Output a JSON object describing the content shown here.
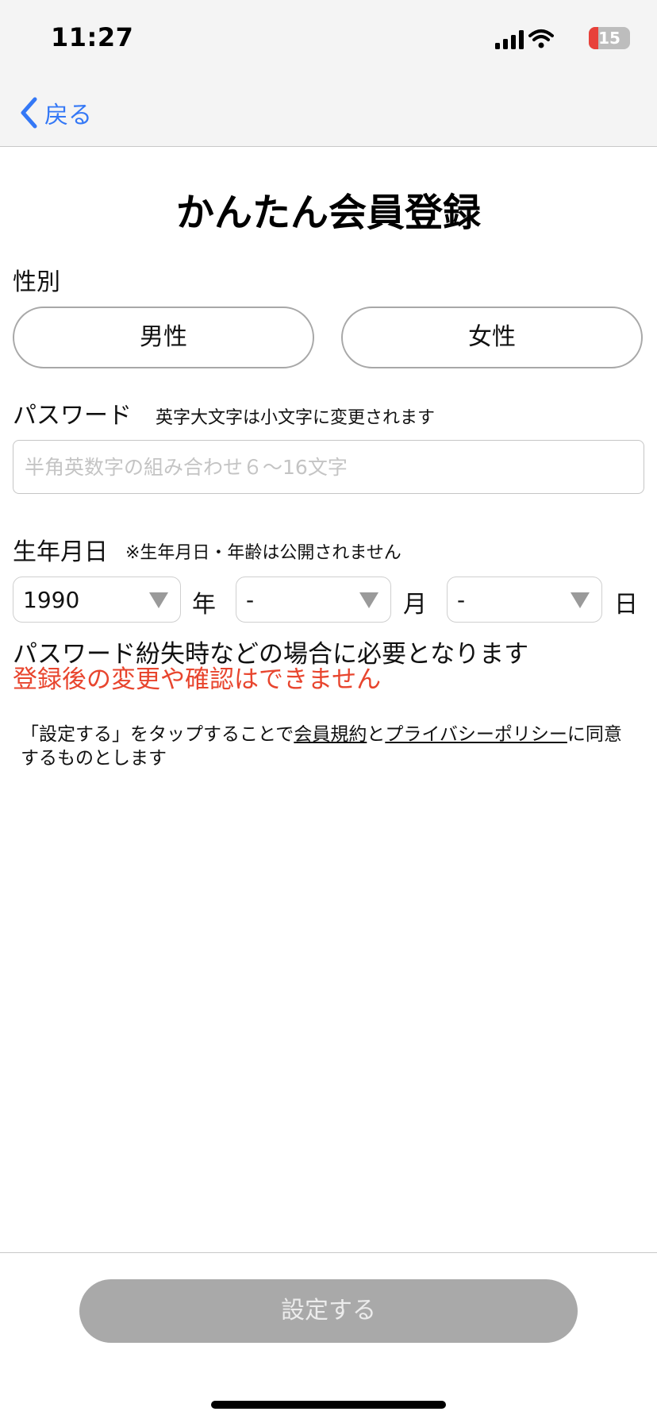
{
  "status_bar": {
    "time": "11:27",
    "battery_level": "15",
    "battery_color": "#e8413a"
  },
  "nav": {
    "back_label": "戻る",
    "back_icon": "chevron-left-icon",
    "accent_color": "#3478f6"
  },
  "title": "かんたん会員登録",
  "gender": {
    "label": "性別",
    "options": [
      "男性",
      "女性"
    ]
  },
  "password": {
    "label": "パスワード",
    "note": "英字大文字は小文字に変更されます",
    "placeholder": "半角英数字の組み合わせ６～16文字",
    "value": ""
  },
  "birthdate": {
    "label": "生年月日",
    "note": "※生年月日・年齢は公開されません",
    "year_value": "1990",
    "year_unit": "年",
    "month_value": "-",
    "month_unit": "月",
    "day_value": "-",
    "day_unit": "日"
  },
  "notice": {
    "line1": "パスワード紛失時などの場合に必要となります",
    "line2": "登録後の変更や確認はできません",
    "warning_color": "#e8452e"
  },
  "terms": {
    "prefix": "「設定する」をタップすることで",
    "link1": "会員規約",
    "connector": "と",
    "link2": "プライバシーポリシー",
    "suffix": "に同意するものとします"
  },
  "submit": {
    "label": "設定する",
    "disabled_color": "#a9a9a9"
  }
}
